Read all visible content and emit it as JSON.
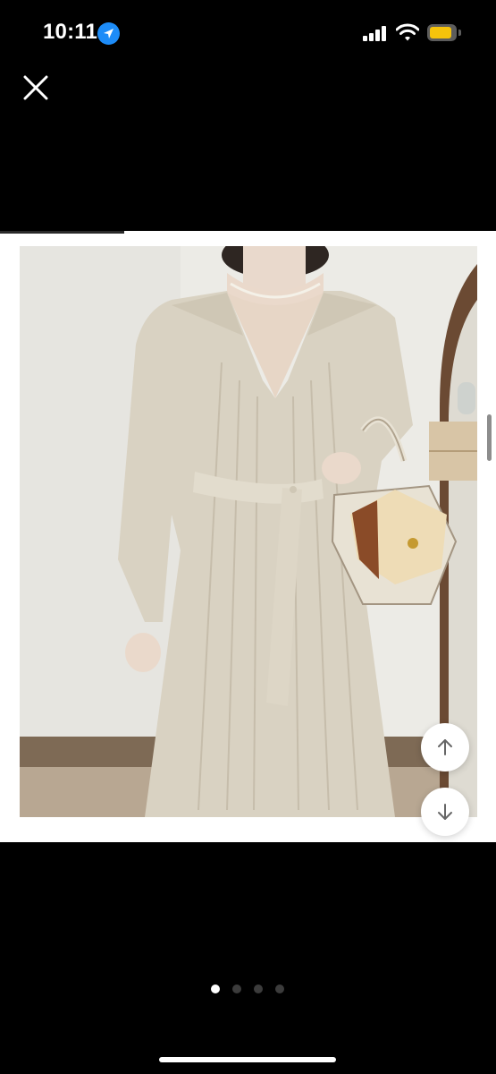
{
  "status_bar": {
    "time": "10:11",
    "location_icon": "location-arrow-icon",
    "signal_icon": "cellular-signal-icon",
    "wifi_icon": "wifi-icon",
    "battery_icon": "battery-icon",
    "battery_color": "#f5c30b",
    "location_color": "#1d8cf8"
  },
  "viewer": {
    "close_icon": "close-icon",
    "image_icon": "product-photo",
    "image_progress": 0.25,
    "scroll_up_icon": "arrow-up-icon",
    "scroll_down_icon": "arrow-down-icon"
  },
  "pagination": {
    "total": 4,
    "current": 1
  },
  "colors": {
    "background": "#000000",
    "dress": "#d9d2c2",
    "wall": "#ecebe6"
  }
}
